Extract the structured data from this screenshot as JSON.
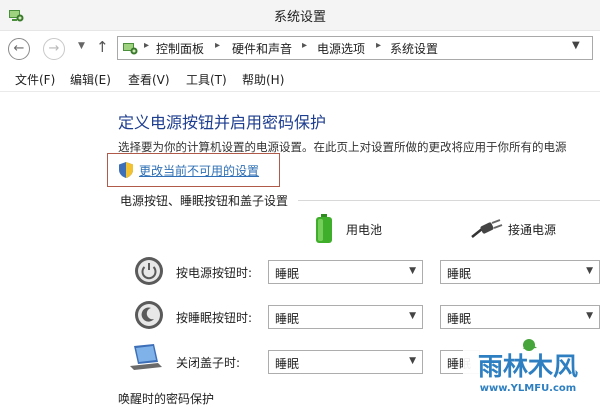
{
  "window": {
    "title": "系统设置"
  },
  "address_bar": {
    "crumbs": [
      "控制面板",
      "硬件和声音",
      "电源选项",
      "系统设置"
    ]
  },
  "menu": [
    "文件(F)",
    "编辑(E)",
    "查看(V)",
    "工具(T)",
    "帮助(H)"
  ],
  "content": {
    "heading": "定义电源按钮并启用密码保护",
    "description": "选择要为你的计算机设置的电源设置。在此页上对设置所做的更改将应用于你所有的电源",
    "change_link": "更改当前不可用的设置",
    "section_title": "电源按钮、睡眠按钮和盖子设置",
    "columns": {
      "battery": "用电池",
      "plugged": "接通电源"
    },
    "rows": [
      {
        "label": "按电源按钮时:",
        "battery_value": "睡眠",
        "plugged_value": "睡眠",
        "icon": "power-icon"
      },
      {
        "label": "按睡眠按钮时:",
        "battery_value": "睡眠",
        "plugged_value": "睡眠",
        "icon": "sleep-icon"
      },
      {
        "label": "关闭盖子时:",
        "battery_value": "睡眠",
        "plugged_value": "睡眠",
        "icon": "laptop-lid-icon"
      }
    ],
    "wake_title": "唤醒时的密码保护"
  },
  "watermark": {
    "name": "雨林木风",
    "url": "www.YLMFU.com"
  },
  "colors": {
    "heading": "#1d3d8f",
    "link": "#2e6fb5",
    "highlight_border": "#b05a4a",
    "battery_green": "#3fae2a"
  }
}
